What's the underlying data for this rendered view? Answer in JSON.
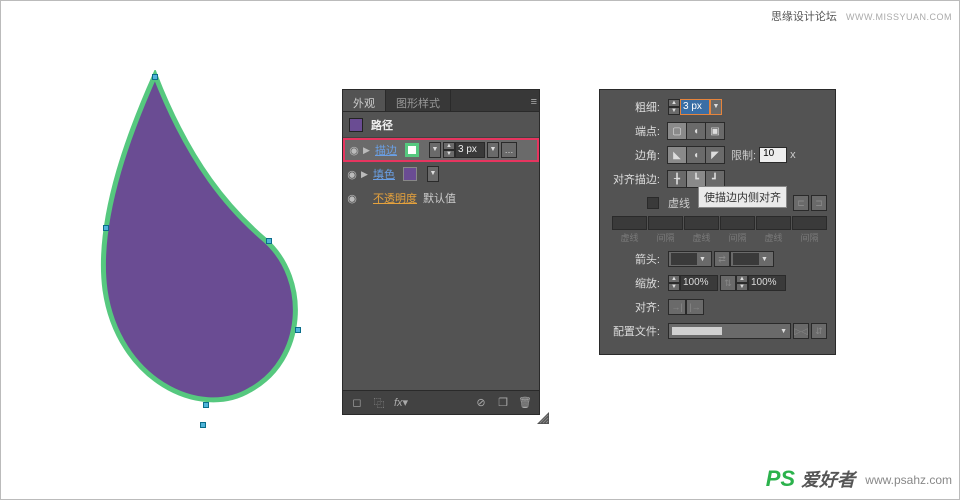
{
  "watermark": {
    "top_text": "思缘设计论坛",
    "top_url": "WWW.MISSYUAN.COM",
    "logo_main": "PS",
    "logo_sub": "爱好者",
    "logo_url": "www.psahz.com"
  },
  "shape": {
    "fill": "#6a4c93",
    "stroke": "#56c87f",
    "anchors": 6
  },
  "appearance": {
    "tab1": "外观",
    "tab2": "图形样式",
    "title": "路径",
    "rows": [
      {
        "label": "描边",
        "value": "3 px",
        "selected": true
      },
      {
        "label": "填色",
        "value": ""
      },
      {
        "label": "不透明度",
        "value": "默认值"
      }
    ],
    "footer_icons": [
      "new",
      "dup",
      "fx",
      "",
      "clear",
      "del"
    ]
  },
  "stroke": {
    "weight_label": "粗细:",
    "weight_value": "3 px",
    "cap_label": "端点:",
    "corner_label": "边角:",
    "limit_label": "限制:",
    "limit_value": "10",
    "limit_suffix": "x",
    "align_label": "对齐描边:",
    "dash_check": "虚线",
    "tooltip": "使描边内侧对齐",
    "dash_cells": [
      "虚线",
      "间隔",
      "虚线",
      "间隔",
      "虚线",
      "间隔"
    ],
    "arrow_label": "箭头:",
    "scale_label": "缩放:",
    "scale_value": "100%",
    "arrow_align_label": "对齐:",
    "profile_label": "配置文件:"
  }
}
